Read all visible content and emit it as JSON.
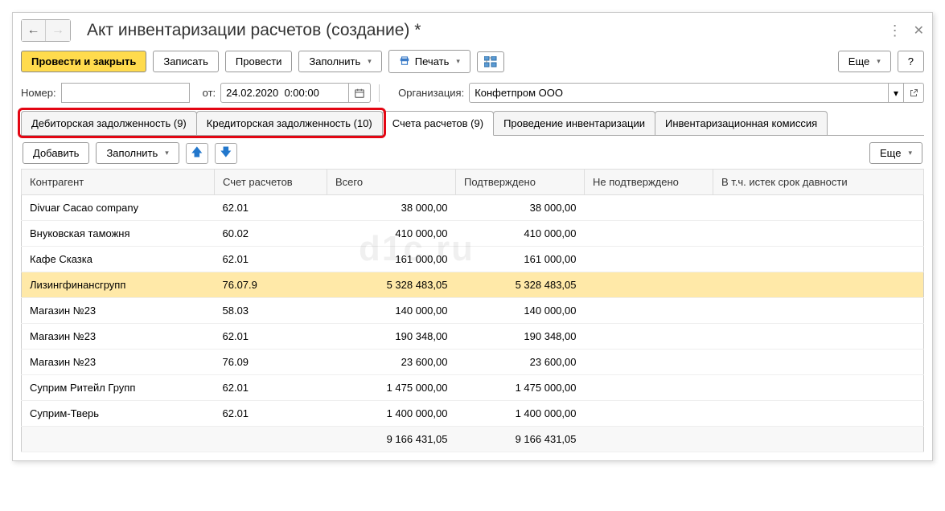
{
  "header": {
    "title": "Акт инвентаризации расчетов (создание) *"
  },
  "toolbar": {
    "post_close": "Провести и закрыть",
    "write": "Записать",
    "post": "Провести",
    "fill": "Заполнить",
    "print": "Печать",
    "more": "Еще",
    "help": "?"
  },
  "form": {
    "number_label": "Номер:",
    "number_value": "",
    "date_label": "от:",
    "date_value": "24.02.2020  0:00:00",
    "org_label": "Организация:",
    "org_value": "Конфетпром ООО"
  },
  "tabs": [
    {
      "label": "Дебиторская задолженность (9)",
      "active": false,
      "highlight": true
    },
    {
      "label": "Кредиторская задолженность (10)",
      "active": false,
      "highlight": true
    },
    {
      "label": "Счета расчетов (9)",
      "active": true
    },
    {
      "label": "Проведение инвентаризации",
      "active": false
    },
    {
      "label": "Инвентаризационная комиссия",
      "active": false
    }
  ],
  "tab_toolbar": {
    "add": "Добавить",
    "fill": "Заполнить",
    "more": "Еще"
  },
  "table": {
    "columns": {
      "contractor": "Контрагент",
      "account": "Счет расчетов",
      "total": "Всего",
      "confirmed": "Подтверждено",
      "unconfirmed": "Не подтверждено",
      "expired": "В т.ч. истек срок давности"
    },
    "rows": [
      {
        "contractor": "Divuar Cacao company",
        "account": "62.01",
        "total": "38 000,00",
        "confirmed": "38 000,00",
        "unconfirmed": "",
        "expired": "",
        "selected": false
      },
      {
        "contractor": "Внуковская таможня",
        "account": "60.02",
        "total": "410 000,00",
        "confirmed": "410 000,00",
        "unconfirmed": "",
        "expired": "",
        "selected": false
      },
      {
        "contractor": "Кафе Сказка",
        "account": "62.01",
        "total": "161 000,00",
        "confirmed": "161 000,00",
        "unconfirmed": "",
        "expired": "",
        "selected": false
      },
      {
        "contractor": "Лизингфинансгрупп",
        "account": "76.07.9",
        "total": "5 328 483,05",
        "confirmed": "5 328 483,05",
        "unconfirmed": "",
        "expired": "",
        "selected": true
      },
      {
        "contractor": "Магазин №23",
        "account": "58.03",
        "total": "140 000,00",
        "confirmed": "140 000,00",
        "unconfirmed": "",
        "expired": "",
        "selected": false
      },
      {
        "contractor": "Магазин №23",
        "account": "62.01",
        "total": "190 348,00",
        "confirmed": "190 348,00",
        "unconfirmed": "",
        "expired": "",
        "selected": false
      },
      {
        "contractor": "Магазин №23",
        "account": "76.09",
        "total": "23 600,00",
        "confirmed": "23 600,00",
        "unconfirmed": "",
        "expired": "",
        "selected": false
      },
      {
        "contractor": "Суприм Ритейл Групп",
        "account": "62.01",
        "total": "1 475 000,00",
        "confirmed": "1 475 000,00",
        "unconfirmed": "",
        "expired": "",
        "selected": false
      },
      {
        "contractor": "Суприм-Тверь",
        "account": "62.01",
        "total": "1 400 000,00",
        "confirmed": "1 400 000,00",
        "unconfirmed": "",
        "expired": "",
        "selected": false
      }
    ],
    "footer": {
      "total": "9 166 431,05",
      "confirmed": "9 166 431,05"
    }
  },
  "watermark": "d1c.ru"
}
